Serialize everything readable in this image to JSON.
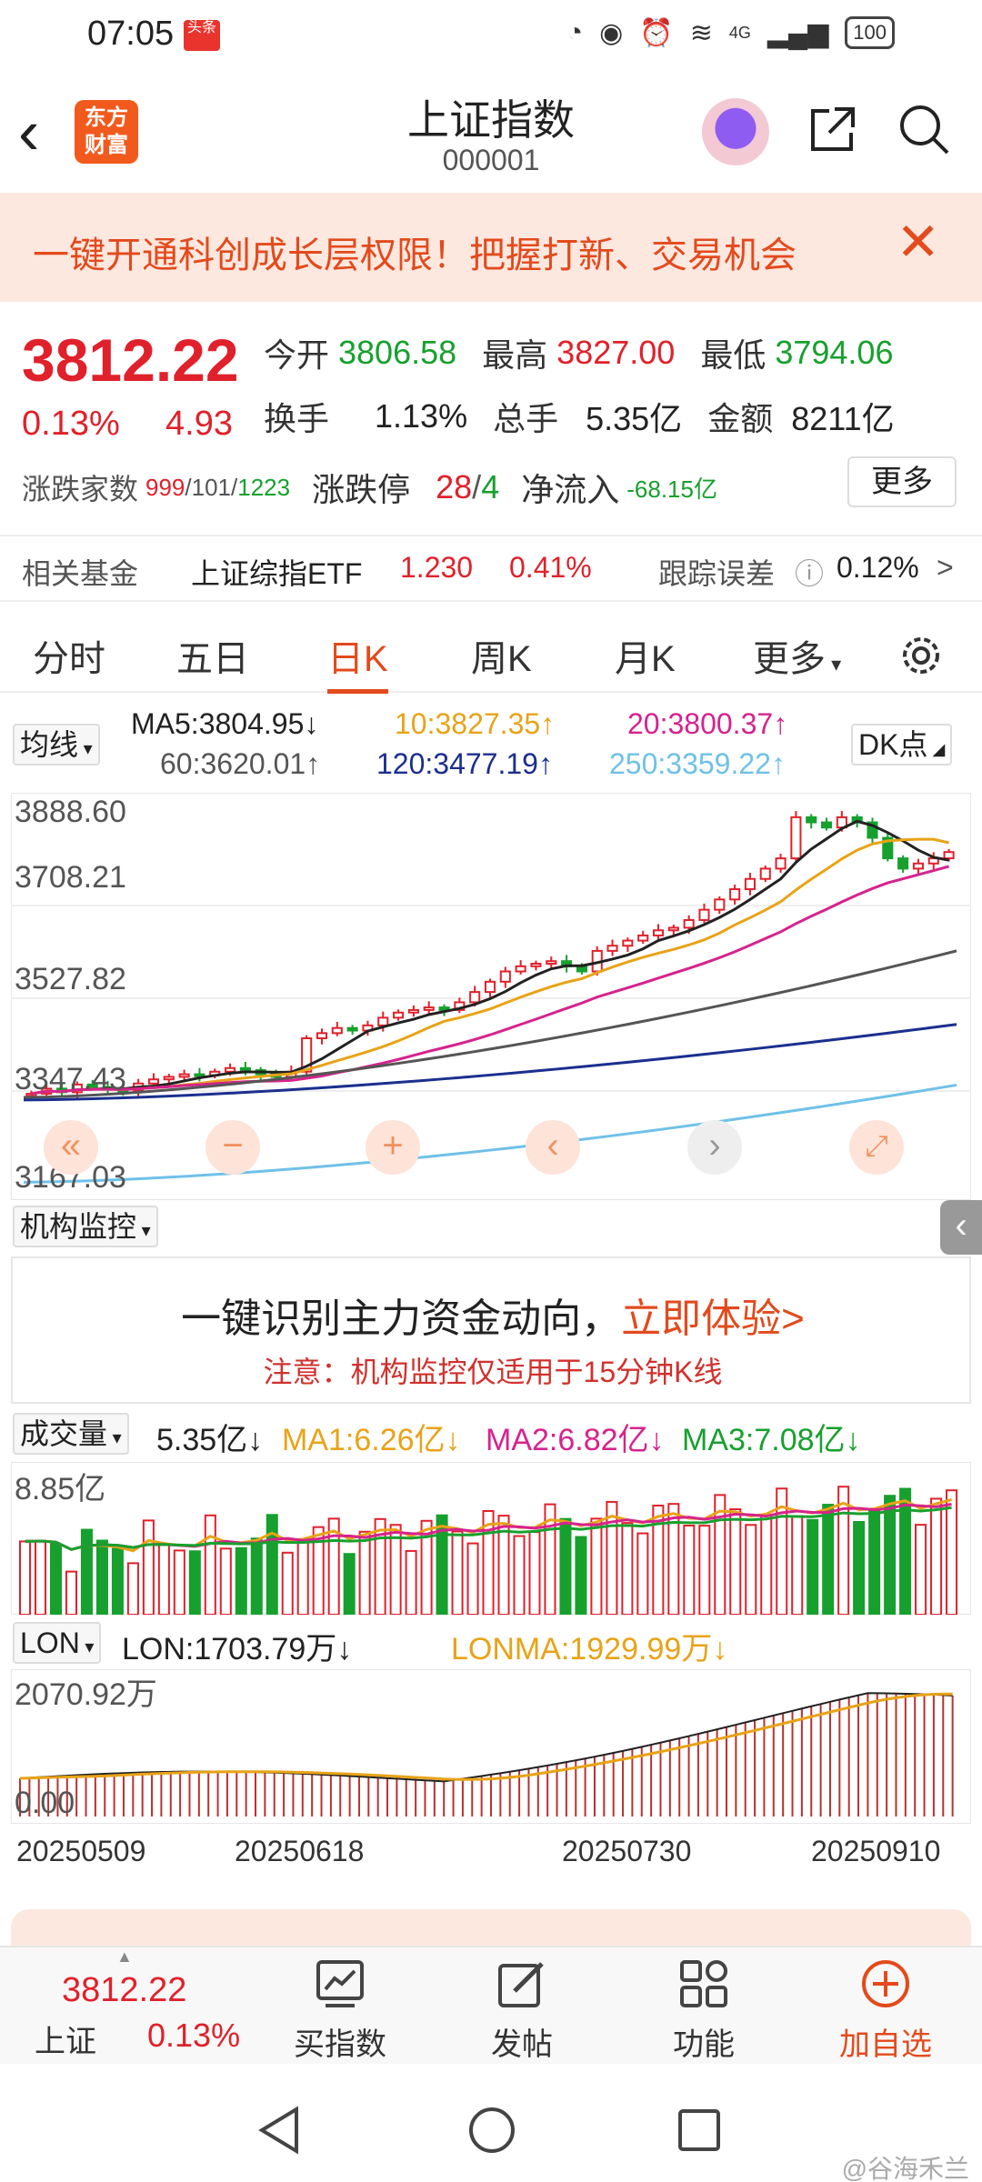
{
  "status": {
    "time": "07:05",
    "app_badge": "头条",
    "network": "4G",
    "battery": "100"
  },
  "header": {
    "logo_text": "东方财富",
    "title": "上证指数",
    "code": "000001"
  },
  "banner": {
    "text": "一键开通科创成长层权限！把握打新、交易机会",
    "close": "✕"
  },
  "quote": {
    "price": "3812.22",
    "pct": "0.13%",
    "change": "4.93",
    "open_label": "今开",
    "open": "3806.58",
    "high_label": "最高",
    "high": "3827.00",
    "low_label": "最低",
    "low": "3794.06",
    "turnover_label": "换手",
    "turnover": "1.13%",
    "volume_label": "总手",
    "volume": "5.35亿",
    "amount_label": "金额",
    "amount": "8211亿",
    "breadth_label": "涨跌家数",
    "breadth_up": "999",
    "breadth_flat": "101",
    "breadth_down": "1223",
    "limit_label": "涨跌停",
    "limit_up": "28",
    "limit_down": "4",
    "inflow_label": "净流入",
    "inflow": "-68.15亿",
    "more": "更多"
  },
  "fund": {
    "label": "相关基金",
    "name": "上证综指ETF",
    "price": "1.230",
    "pct": "0.41%",
    "error_label": "跟踪误差",
    "error": "0.12%",
    "arrow": ">"
  },
  "tabs": [
    "分时",
    "五日",
    "日K",
    "周K",
    "月K",
    "更多"
  ],
  "active_tab": 2,
  "ma": {
    "selector": "均线",
    "ma5": "MA5:3804.95↓",
    "ma10": "10:3827.35↑",
    "ma20": "20:3800.37↑",
    "ma60": "60:3620.01↑",
    "ma120": "120:3477.19↑",
    "ma250": "250:3359.22↑",
    "dk": "DK点",
    "colors": {
      "ma5": "#222222",
      "ma10": "#e8a317",
      "ma20": "#d6238d",
      "ma60": "#555555",
      "ma120": "#1b2f8f",
      "ma250": "#6fc1e8"
    }
  },
  "kchart_axis": [
    "3888.60",
    "3708.21",
    "3527.82",
    "3347.43",
    "3167.03"
  ],
  "institution": {
    "selector": "机构监控",
    "headline": "一键识别主力资金动向，",
    "cta": "立即体验>",
    "note": "注意：机构监控仅适用于15分钟K线"
  },
  "volume": {
    "selector": "成交量",
    "value": "5.35亿↓",
    "ma1": "MA1:6.26亿↓",
    "ma2": "MA2:6.82亿↓",
    "ma3": "MA3:7.08亿↓",
    "axis_max": "8.85亿"
  },
  "lon": {
    "selector": "LON",
    "value": "LON:1703.79万↓",
    "lonma": "LONMA:1929.99万↓",
    "axis_max": "2070.92万",
    "axis_min": "0.00"
  },
  "dates": [
    "20250509",
    "20250618",
    "20250730",
    "20250910"
  ],
  "bottom": {
    "index_price": "3812.22",
    "index_name": "上证",
    "index_pct": "0.13%",
    "buy": "买指数",
    "post": "发帖",
    "func": "功能",
    "add": "加自选"
  },
  "watermark": "@谷海禾兰",
  "chart_data": [
    {
      "type": "candlestick",
      "title": "日K",
      "ylim": [
        3167.03,
        3888.6
      ],
      "close_approx": [
        3342,
        3352,
        3345,
        3360,
        3355,
        3350,
        3348,
        3362,
        3370,
        3375,
        3380,
        3378,
        3385,
        3392,
        3388,
        3380,
        3375,
        3385,
        3450,
        3460,
        3470,
        3465,
        3475,
        3490,
        3500,
        3505,
        3510,
        3505,
        3520,
        3540,
        3560,
        3580,
        3590,
        3595,
        3600,
        3590,
        3580,
        3620,
        3630,
        3640,
        3650,
        3660,
        3665,
        3680,
        3700,
        3720,
        3740,
        3760,
        3780,
        3800,
        3880,
        3870,
        3860,
        3880,
        3870,
        3840,
        3800,
        3780,
        3790,
        3800,
        3812.22
      ]
    }
  ]
}
